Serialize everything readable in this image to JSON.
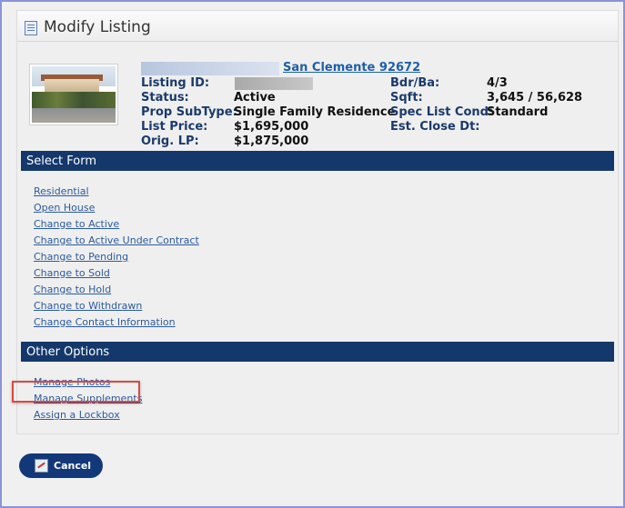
{
  "header": {
    "title": "Modify Listing"
  },
  "listing": {
    "address_link": "San Clemente 92672",
    "fields_left": [
      {
        "label": "Listing ID:",
        "value": ""
      },
      {
        "label": "Status:",
        "value": "Active"
      },
      {
        "label": "Prop SubType:",
        "value": "Single Family Residence"
      },
      {
        "label": "List Price:",
        "value": "$1,695,000"
      },
      {
        "label": "Orig. LP:",
        "value": "$1,875,000"
      }
    ],
    "fields_right": [
      {
        "label": "Bdr/Ba:",
        "value": "4/3"
      },
      {
        "label": "Sqft:",
        "value": "3,645 / 56,628"
      },
      {
        "label": "Spec List Cond:",
        "value": "Standard"
      },
      {
        "label": "Est. Close Dt:",
        "value": ""
      }
    ]
  },
  "select_form": {
    "heading": "Select Form",
    "links": [
      "Residential",
      "Open House",
      "Change to Active",
      "Change to Active Under Contract",
      "Change to Pending",
      "Change to Sold",
      "Change to Hold",
      "Change to Withdrawn",
      "Change Contact Information"
    ]
  },
  "other_options": {
    "heading": "Other Options",
    "links": [
      "Manage Photos",
      "Manage Supplements",
      "Assign a Lockbox"
    ]
  },
  "footer": {
    "cancel_label": "Cancel"
  },
  "colors": {
    "section_bar": "#14386b",
    "link": "#2b5b9e",
    "highlight": "#e0463e",
    "button": "#13387a"
  }
}
